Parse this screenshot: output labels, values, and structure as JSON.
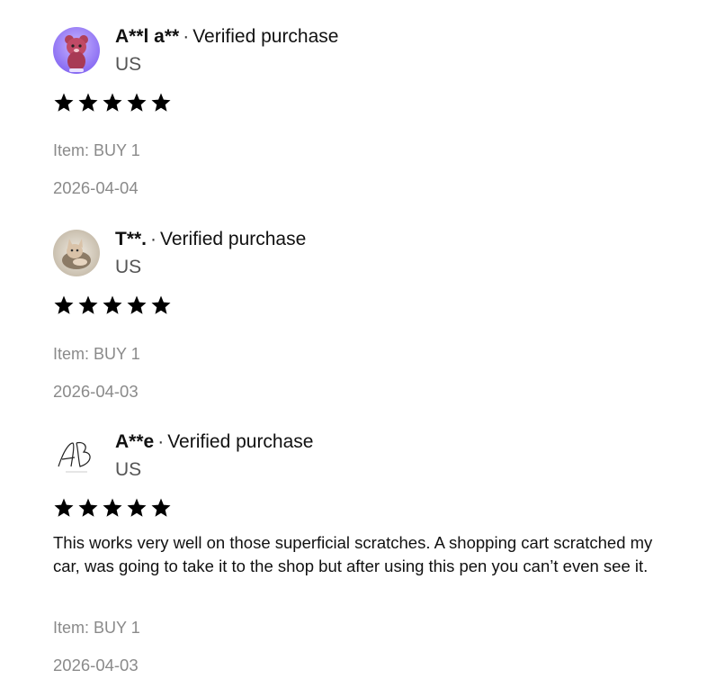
{
  "reviews": [
    {
      "name": "A**l a**",
      "badge": "Verified purchase",
      "separator": "·",
      "country": "US",
      "rating": 5,
      "text": "",
      "item": "Item: BUY 1",
      "date": "2026-04-04",
      "avatar_icon": "bear-toy-avatar-icon"
    },
    {
      "name": "T**.",
      "badge": "Verified purchase",
      "separator": "·",
      "country": "US",
      "rating": 5,
      "text": "",
      "item": "Item: BUY 1",
      "date": "2026-04-03",
      "avatar_icon": "cat-avatar-icon"
    },
    {
      "name": "A**e",
      "badge": "Verified purchase",
      "separator": "·",
      "country": "US",
      "rating": 5,
      "text": "This works very well on those superficial scratches. A shopping cart scratched my car, was going to take it to the shop but after using this pen you can’t even see it.",
      "item": "Item: BUY 1",
      "date": "2026-04-03",
      "avatar_icon": "monogram-avatar-icon"
    }
  ],
  "colors": {
    "star": "#000000",
    "meta_text": "#8a8a8a",
    "country_text": "#555555"
  }
}
